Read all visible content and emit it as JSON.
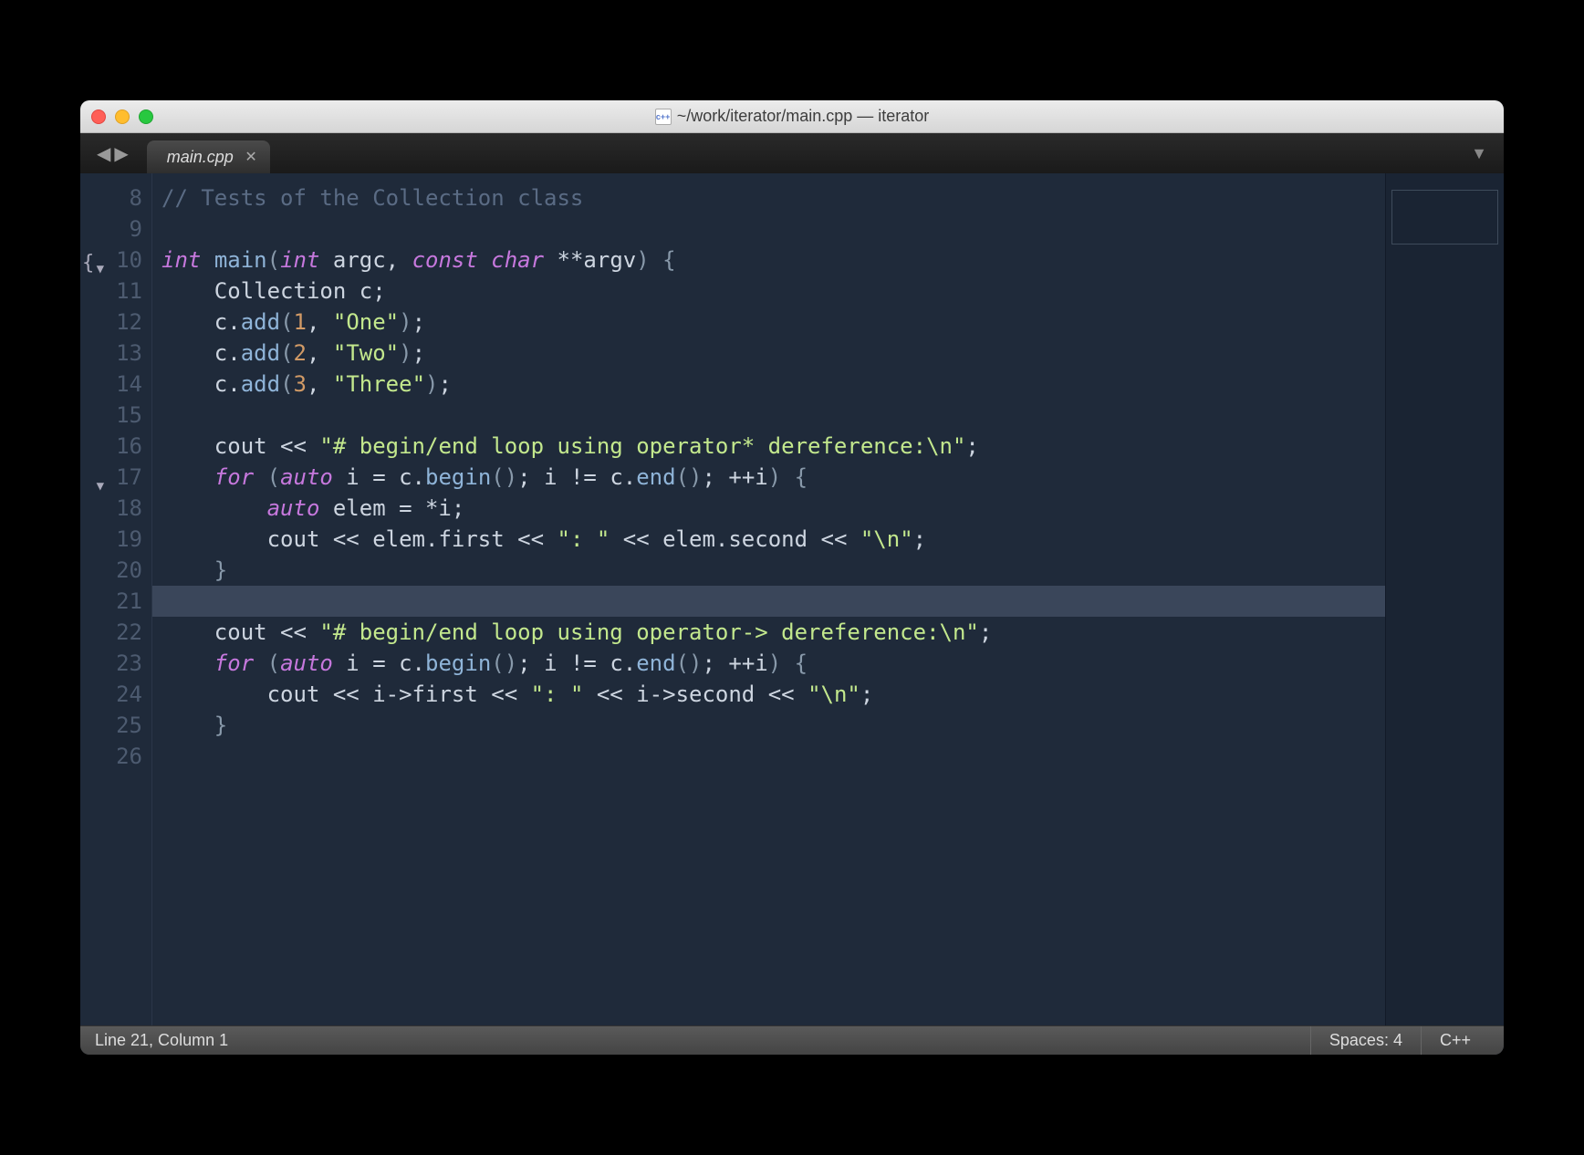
{
  "window": {
    "title": "~/work/iterator/main.cpp — iterator"
  },
  "tabbar": {
    "tab_label": "main.cpp"
  },
  "statusbar": {
    "position": "Line 21, Column 1",
    "spaces": "Spaces: 4",
    "syntax": "C++"
  },
  "editor": {
    "first_line_number": 8,
    "current_line": 21,
    "fold_lines": [
      10,
      17
    ],
    "brace_line": 10,
    "lines": [
      [
        {
          "cls": "c-comment",
          "t": "// Tests of the Collection class"
        }
      ],
      [],
      [
        {
          "cls": "c-type",
          "t": "int"
        },
        {
          "t": " "
        },
        {
          "cls": "c-func",
          "t": "main"
        },
        {
          "cls": "c-punc",
          "t": "("
        },
        {
          "cls": "c-type",
          "t": "int"
        },
        {
          "t": " argc, "
        },
        {
          "cls": "c-type",
          "t": "const char"
        },
        {
          "t": " **argv"
        },
        {
          "cls": "c-punc",
          "t": ")"
        },
        {
          "t": " "
        },
        {
          "cls": "c-punc",
          "t": "{"
        }
      ],
      [
        {
          "t": "    Collection c;"
        }
      ],
      [
        {
          "t": "    c."
        },
        {
          "cls": "c-func",
          "t": "add"
        },
        {
          "cls": "c-punc",
          "t": "("
        },
        {
          "cls": "c-num",
          "t": "1"
        },
        {
          "t": ", "
        },
        {
          "cls": "c-string",
          "t": "\"One\""
        },
        {
          "cls": "c-punc",
          "t": ")"
        },
        {
          "t": ";"
        }
      ],
      [
        {
          "t": "    c."
        },
        {
          "cls": "c-func",
          "t": "add"
        },
        {
          "cls": "c-punc",
          "t": "("
        },
        {
          "cls": "c-num",
          "t": "2"
        },
        {
          "t": ", "
        },
        {
          "cls": "c-string",
          "t": "\"Two\""
        },
        {
          "cls": "c-punc",
          "t": ")"
        },
        {
          "t": ";"
        }
      ],
      [
        {
          "t": "    c."
        },
        {
          "cls": "c-func",
          "t": "add"
        },
        {
          "cls": "c-punc",
          "t": "("
        },
        {
          "cls": "c-num",
          "t": "3"
        },
        {
          "t": ", "
        },
        {
          "cls": "c-string",
          "t": "\"Three\""
        },
        {
          "cls": "c-punc",
          "t": ")"
        },
        {
          "t": ";"
        }
      ],
      [],
      [
        {
          "t": "    cout "
        },
        {
          "cls": "c-op",
          "t": "<<"
        },
        {
          "t": " "
        },
        {
          "cls": "c-string",
          "t": "\"# begin/end loop using operator* dereference:\\n\""
        },
        {
          "t": ";"
        }
      ],
      [
        {
          "t": "    "
        },
        {
          "cls": "c-keyword",
          "t": "for"
        },
        {
          "t": " "
        },
        {
          "cls": "c-punc",
          "t": "("
        },
        {
          "cls": "c-type",
          "t": "auto"
        },
        {
          "t": " i = c."
        },
        {
          "cls": "c-func",
          "t": "begin"
        },
        {
          "cls": "c-punc",
          "t": "()"
        },
        {
          "t": "; i != c."
        },
        {
          "cls": "c-func",
          "t": "end"
        },
        {
          "cls": "c-punc",
          "t": "()"
        },
        {
          "t": "; ++i"
        },
        {
          "cls": "c-punc",
          "t": ")"
        },
        {
          "t": " "
        },
        {
          "cls": "c-punc",
          "t": "{"
        }
      ],
      [
        {
          "t": "        "
        },
        {
          "cls": "c-type",
          "t": "auto"
        },
        {
          "t": " elem = *i;"
        }
      ],
      [
        {
          "t": "        cout "
        },
        {
          "cls": "c-op",
          "t": "<<"
        },
        {
          "t": " elem.first "
        },
        {
          "cls": "c-op",
          "t": "<<"
        },
        {
          "t": " "
        },
        {
          "cls": "c-string",
          "t": "\": \""
        },
        {
          "t": " "
        },
        {
          "cls": "c-op",
          "t": "<<"
        },
        {
          "t": " elem.second "
        },
        {
          "cls": "c-op",
          "t": "<<"
        },
        {
          "t": " "
        },
        {
          "cls": "c-string",
          "t": "\"\\n\""
        },
        {
          "t": ";"
        }
      ],
      [
        {
          "t": "    "
        },
        {
          "cls": "c-punc",
          "t": "}"
        }
      ],
      [],
      [
        {
          "t": "    cout "
        },
        {
          "cls": "c-op",
          "t": "<<"
        },
        {
          "t": " "
        },
        {
          "cls": "c-string",
          "t": "\"# begin/end loop using operator-> dereference:\\n\""
        },
        {
          "t": ";"
        }
      ],
      [
        {
          "t": "    "
        },
        {
          "cls": "c-keyword",
          "t": "for"
        },
        {
          "t": " "
        },
        {
          "cls": "c-punc",
          "t": "("
        },
        {
          "cls": "c-type",
          "t": "auto"
        },
        {
          "t": " i = c."
        },
        {
          "cls": "c-func",
          "t": "begin"
        },
        {
          "cls": "c-punc",
          "t": "()"
        },
        {
          "t": "; i != c."
        },
        {
          "cls": "c-func",
          "t": "end"
        },
        {
          "cls": "c-punc",
          "t": "()"
        },
        {
          "t": "; ++i"
        },
        {
          "cls": "c-punc",
          "t": ")"
        },
        {
          "t": " "
        },
        {
          "cls": "c-punc",
          "t": "{"
        }
      ],
      [
        {
          "t": "        cout "
        },
        {
          "cls": "c-op",
          "t": "<<"
        },
        {
          "t": " i->first "
        },
        {
          "cls": "c-op",
          "t": "<<"
        },
        {
          "t": " "
        },
        {
          "cls": "c-string",
          "t": "\": \""
        },
        {
          "t": " "
        },
        {
          "cls": "c-op",
          "t": "<<"
        },
        {
          "t": " i->second "
        },
        {
          "cls": "c-op",
          "t": "<<"
        },
        {
          "t": " "
        },
        {
          "cls": "c-string",
          "t": "\"\\n\""
        },
        {
          "t": ";"
        }
      ],
      [
        {
          "t": "    "
        },
        {
          "cls": "c-punc",
          "t": "}"
        }
      ],
      []
    ]
  }
}
